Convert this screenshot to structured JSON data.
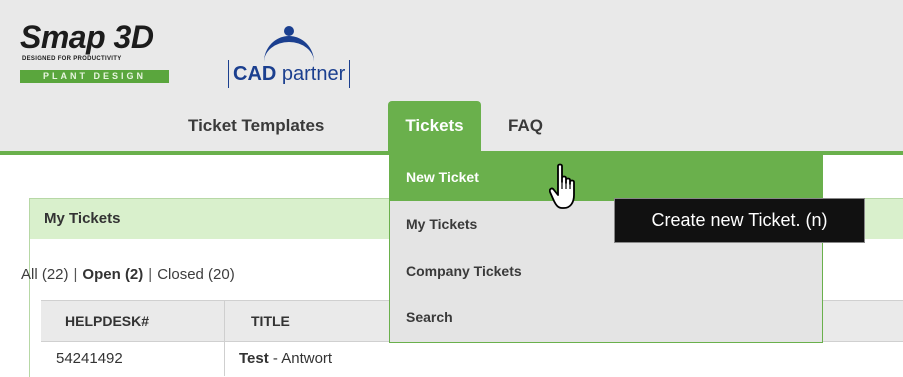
{
  "brand": {
    "name": "Smap 3D",
    "tagline": "DESIGNED FOR PRODUCTIVITY",
    "product": "PLANT DESIGN",
    "color": "#5aa63d"
  },
  "partner": {
    "name_bold": "CAD",
    "name_rest": " partner",
    "color": "#1b3f8f"
  },
  "nav": {
    "items": [
      {
        "label": "Ticket Templates"
      },
      {
        "label": "Tickets",
        "active": true
      },
      {
        "label": "FAQ"
      }
    ],
    "accent": "#6ab04c"
  },
  "dropdown": {
    "items": [
      {
        "label": "New Ticket",
        "highlighted": true
      },
      {
        "label": "My Tickets"
      },
      {
        "label": "Company Tickets"
      },
      {
        "label": "Search"
      }
    ]
  },
  "tooltip": {
    "text": "Create new Ticket. (n)"
  },
  "panel": {
    "title": "My Tickets",
    "filters": {
      "all": "All (22)",
      "open_label": "Open",
      "open_count": "(2)",
      "closed": "Closed (20)",
      "separator": "|"
    },
    "columns": [
      "HELPDESK#",
      "TITLE"
    ],
    "rows": [
      {
        "id": "54241492",
        "title_bold": "Test",
        "title_rest": " - Antwort"
      }
    ]
  },
  "icons": {
    "cursor": "hand-pointer-icon"
  }
}
